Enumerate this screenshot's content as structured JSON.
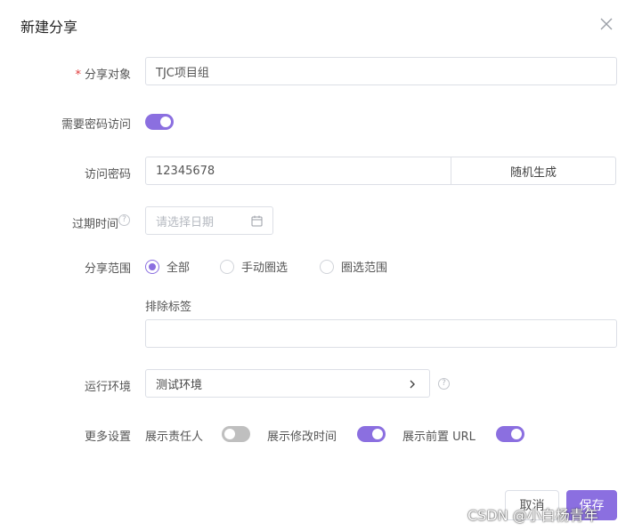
{
  "dialog": {
    "title": "新建分享"
  },
  "form": {
    "share_target": {
      "label": "分享对象",
      "value": "TJC项目组"
    },
    "password_required": {
      "label": "需要密码访问",
      "on": true
    },
    "password": {
      "label": "访问密码",
      "value": "12345678",
      "generate_label": "随机生成"
    },
    "expiry": {
      "label": "过期时间",
      "placeholder": "请选择日期"
    },
    "scope": {
      "label": "分享范围",
      "options": [
        "全部",
        "手动圈选",
        "圈选范围"
      ],
      "selected": "全部"
    },
    "exclude_tags": {
      "label": "排除标签",
      "value": ""
    },
    "environment": {
      "label": "运行环境",
      "value": "测试环境"
    },
    "more_settings": {
      "label": "更多设置",
      "show_owner": {
        "label": "展示责任人",
        "on": false
      },
      "show_modified": {
        "label": "展示修改时间",
        "on": true
      },
      "show_prefix_url": {
        "label": "展示前置 URL",
        "on": true
      }
    }
  },
  "footer": {
    "cancel_label": "取消",
    "save_label": "保存"
  },
  "watermark": "CSDN @小白杨青年",
  "colors": {
    "accent": "#8b6fe0",
    "required": "#e03a3a"
  },
  "icons": [
    "close-icon",
    "help-icon",
    "calendar-icon",
    "chevron-right-icon"
  ]
}
